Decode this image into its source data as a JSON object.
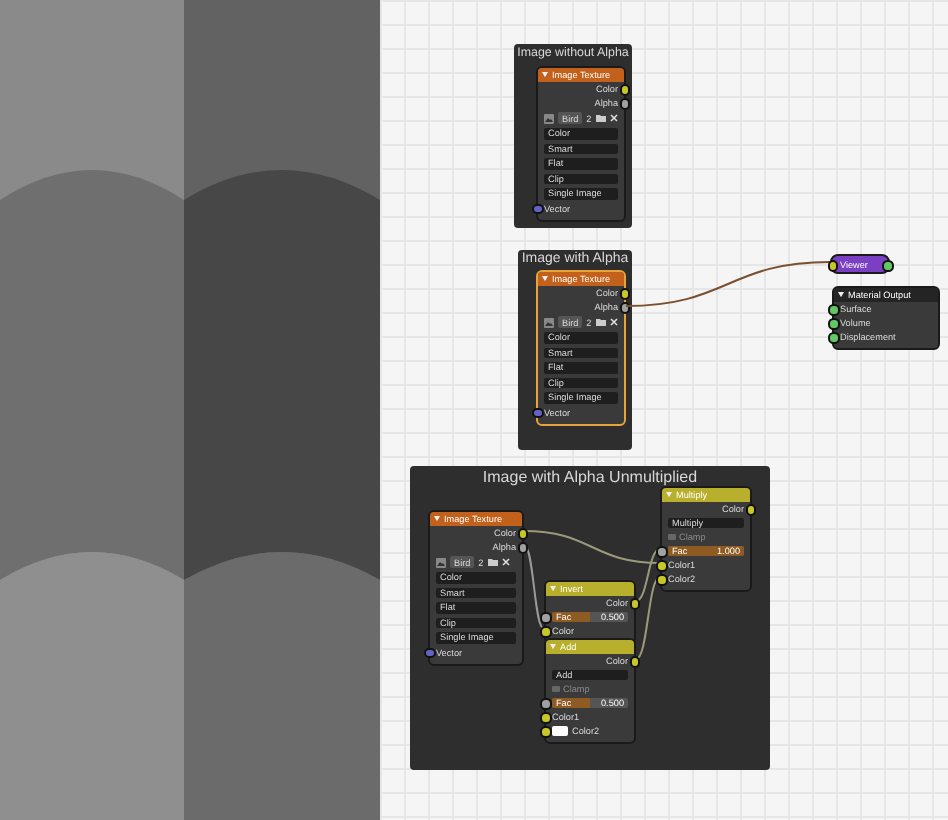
{
  "frames": [
    {
      "title": "Image without Alpha",
      "nodes": [
        {
          "kind": "image_texture",
          "title": "Image Texture",
          "selected": false,
          "outputs": [
            {
              "label": "Color",
              "kind": "color"
            },
            {
              "label": "Alpha",
              "kind": "value"
            }
          ],
          "image": "Bird",
          "users": "2",
          "options": [
            "Color",
            "Smart",
            "Flat",
            "Clip",
            "Single Image"
          ],
          "inputs": [
            {
              "label": "Vector",
              "kind": "vector"
            }
          ]
        }
      ]
    },
    {
      "title": "Image with Alpha",
      "nodes": [
        {
          "kind": "image_texture",
          "title": "Image Texture",
          "selected": true,
          "outputs": [
            {
              "label": "Color",
              "kind": "color"
            },
            {
              "label": "Alpha",
              "kind": "value"
            }
          ],
          "image": "Bird",
          "users": "2",
          "options": [
            "Color",
            "Smart",
            "Flat",
            "Clip",
            "Single Image"
          ],
          "inputs": [
            {
              "label": "Vector",
              "kind": "vector"
            }
          ]
        }
      ]
    },
    {
      "title": "Image with Alpha Unmultiplied",
      "nodes": [
        {
          "kind": "image_texture",
          "title": "Image Texture",
          "selected": false,
          "outputs": [
            {
              "label": "Color",
              "kind": "color"
            },
            {
              "label": "Alpha",
              "kind": "value"
            }
          ],
          "image": "Bird",
          "users": "2",
          "options": [
            "Color",
            "Smart",
            "Flat",
            "Clip",
            "Single Image"
          ],
          "inputs": [
            {
              "label": "Vector",
              "kind": "vector"
            }
          ]
        },
        {
          "kind": "mix",
          "title": "Multiply",
          "outputs": [
            {
              "label": "Color",
              "kind": "color"
            }
          ],
          "blend": "Multiply",
          "clamp": {
            "label": "Clamp",
            "checked": false
          },
          "fac": {
            "label": "Fac",
            "value": "1.000",
            "level": 1
          },
          "inputs": [
            {
              "label": "Color1",
              "kind": "color",
              "swatch": false
            },
            {
              "label": "Color2",
              "kind": "color",
              "swatch": false
            }
          ]
        },
        {
          "kind": "invert",
          "title": "Invert",
          "outputs": [
            {
              "label": "Color",
              "kind": "color"
            }
          ],
          "fac": {
            "label": "Fac",
            "value": "0.500",
            "level": 0.5
          },
          "inputs": [
            {
              "label": "Color",
              "kind": "color",
              "swatch": false
            }
          ]
        },
        {
          "kind": "mix",
          "title": "Add",
          "outputs": [
            {
              "label": "Color",
              "kind": "color"
            }
          ],
          "blend": "Add",
          "clamp": {
            "label": "Clamp",
            "checked": false
          },
          "fac": {
            "label": "Fac",
            "value": "0.500",
            "level": 0.5
          },
          "inputs": [
            {
              "label": "Color1",
              "kind": "color",
              "swatch": false
            },
            {
              "label": "Color2",
              "kind": "color",
              "swatch": true
            }
          ]
        }
      ]
    }
  ],
  "nodes": [
    {
      "kind": "viewer",
      "title": "Viewer"
    },
    {
      "kind": "output",
      "title": "Material Output",
      "inputs": [
        {
          "label": "Surface",
          "kind": "shader"
        },
        {
          "label": "Volume",
          "kind": "shader"
        },
        {
          "label": "Displacement",
          "kind": "shader"
        }
      ]
    }
  ]
}
